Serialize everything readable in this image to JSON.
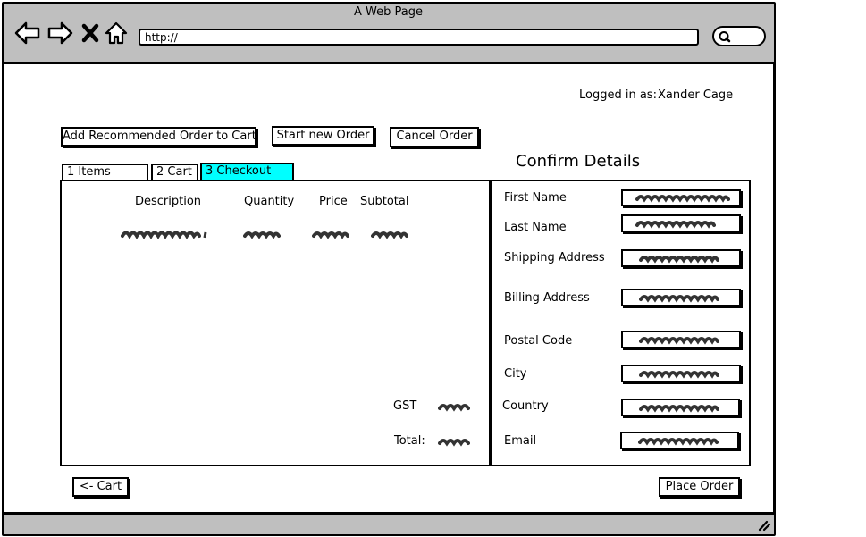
{
  "window": {
    "title": "A Web Page"
  },
  "browser": {
    "url": "http://"
  },
  "header": {
    "logged_in_label": "Logged in as:",
    "user_name": "Xander Cage"
  },
  "toolbar": {
    "add_recommended_label": "Add Recommended Order to Cart",
    "start_new_label": "Start new Order",
    "cancel_label": "Cancel Order"
  },
  "tabs": [
    {
      "label": "1 Items",
      "active": false
    },
    {
      "label": "2 Cart",
      "active": false
    },
    {
      "label": "3 Checkout",
      "active": true
    }
  ],
  "order_table": {
    "columns": [
      "Description",
      "Quantity",
      "Price",
      "Subtotal"
    ],
    "gst_label": "GST",
    "total_label": "Total:"
  },
  "details": {
    "title": "Confirm Details",
    "fields": [
      "First Name",
      "Last Name",
      "Shipping Address",
      "Billing Address",
      "Postal Code",
      "City",
      "Country",
      "Email"
    ]
  },
  "footer": {
    "back_label": "<- Cart",
    "place_order_label": "Place Order"
  },
  "colors": {
    "active_tab": "#00ffff",
    "chrome": "#bfbfbf"
  }
}
